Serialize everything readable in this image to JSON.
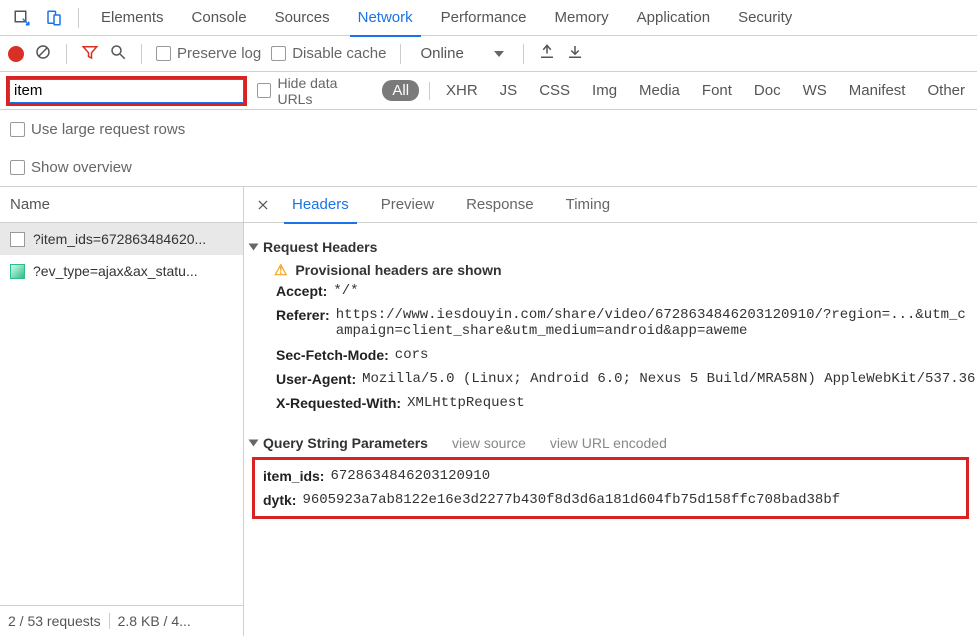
{
  "panel_tabs": {
    "items": [
      "Elements",
      "Console",
      "Sources",
      "Network",
      "Performance",
      "Memory",
      "Application",
      "Security"
    ],
    "active": "Network"
  },
  "net_toolbar": {
    "preserve_log": "Preserve log",
    "disable_cache": "Disable cache",
    "throttling": "Online"
  },
  "filter_bar": {
    "input_value": "item",
    "hide_data_urls": "Hide data URLs",
    "types": {
      "all": "All",
      "xhr": "XHR",
      "js": "JS",
      "css": "CSS",
      "img": "Img",
      "media": "Media",
      "font": "Font",
      "doc": "Doc",
      "ws": "WS",
      "manifest": "Manifest",
      "other": "Other"
    }
  },
  "options": {
    "use_large": "Use large request rows",
    "show_overview": "Show overview"
  },
  "name_col": {
    "header": "Name",
    "rows": [
      {
        "label": "?item_ids=672863484620...",
        "kind": "file"
      },
      {
        "label": "?ev_type=ajax&ax_statu...",
        "kind": "image"
      }
    ]
  },
  "details_tabs": [
    "Headers",
    "Preview",
    "Response",
    "Timing"
  ],
  "headers_view": {
    "request_headers_title": "Request Headers",
    "provisional": "Provisional headers are shown",
    "rows": [
      {
        "k": "Accept:",
        "v": "*/*"
      },
      {
        "k": "Referer:",
        "v": "https://www.iesdouyin.com/share/video/6728634846203120910/?region=...&utm_campaign=client_share&utm_medium=android&app=aweme"
      },
      {
        "k": "Sec-Fetch-Mode:",
        "v": "cors"
      },
      {
        "k": "User-Agent:",
        "v": "Mozilla/5.0 (Linux; Android 6.0; Nexus 5 Build/MRA58N) AppleWebKit/537.36"
      },
      {
        "k": "X-Requested-With:",
        "v": "XMLHttpRequest"
      }
    ],
    "qsp_title": "Query String Parameters",
    "view_source": "view source",
    "view_url_encoded": "view URL encoded",
    "qsp": [
      {
        "k": "item_ids:",
        "v": "6728634846203120910"
      },
      {
        "k": "dytk:",
        "v": "9605923a7ab8122e16e3d2277b430f8d3d6a181d604fb75d158ffc708bad38bf"
      }
    ]
  },
  "status": {
    "requests": "2 / 53 requests",
    "transfer": "2.8 KB / 4..."
  }
}
